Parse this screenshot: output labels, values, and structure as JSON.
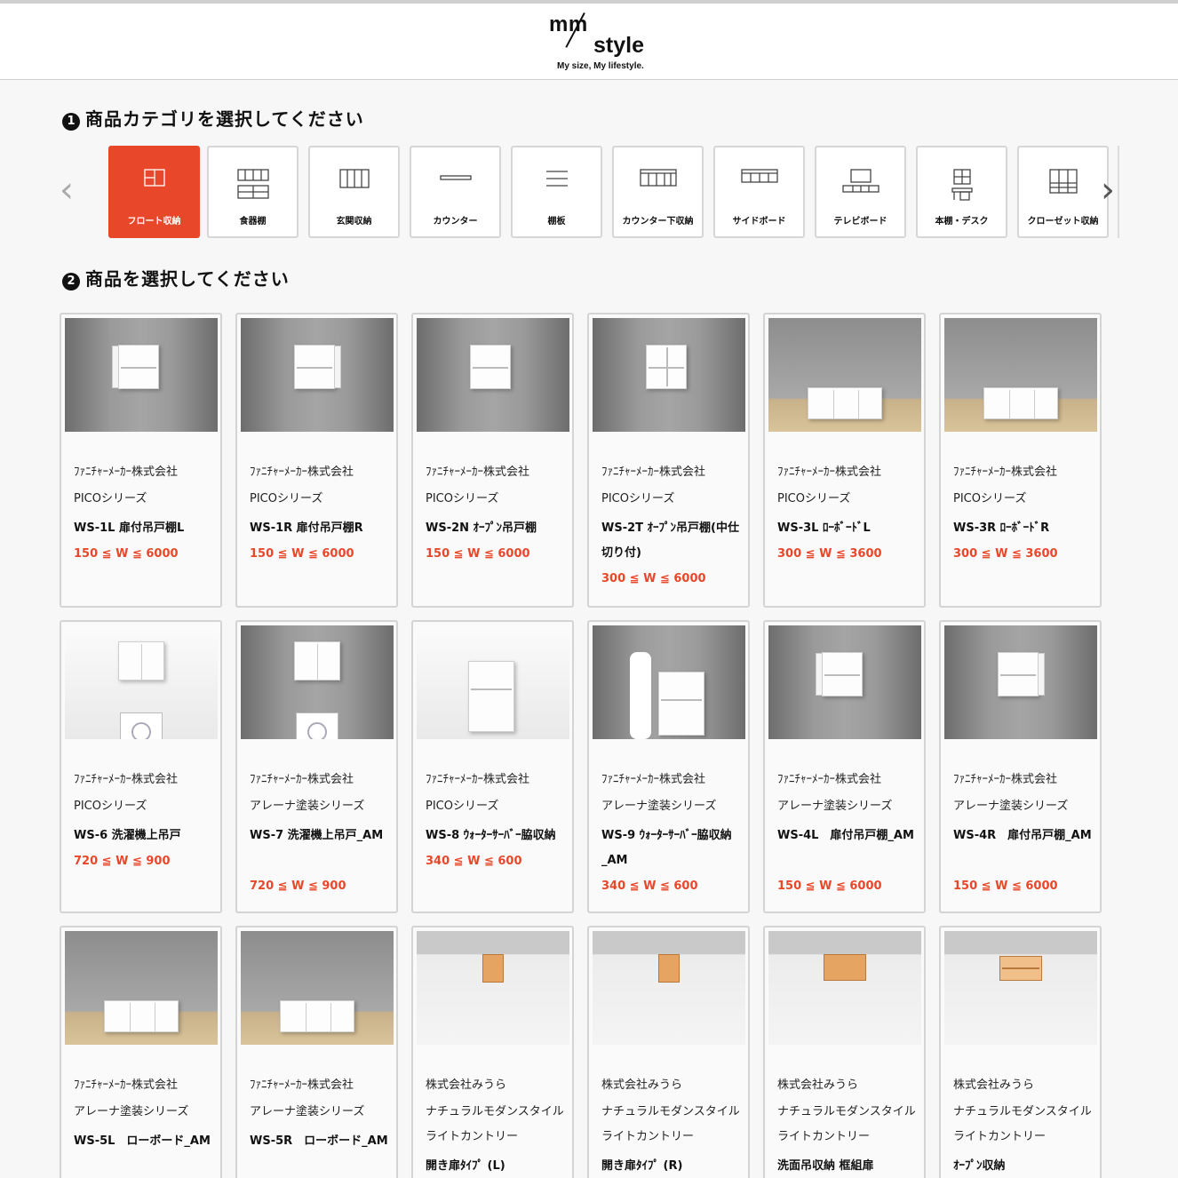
{
  "header": {
    "logo_mm": "mm",
    "logo_style": "style",
    "tagline": "My size, My lifestyle."
  },
  "step1": {
    "num": "1",
    "title": "商品カテゴリを選択してください"
  },
  "step2": {
    "num": "2",
    "title": "商品を選択してください"
  },
  "categories": [
    {
      "label": "フロート収納",
      "icon": "float-storage-icon",
      "active": true
    },
    {
      "label": "食器棚",
      "icon": "cupboard-icon",
      "active": false
    },
    {
      "label": "玄関収納",
      "icon": "entrance-storage-icon",
      "active": false
    },
    {
      "label": "カウンター",
      "icon": "counter-icon",
      "active": false
    },
    {
      "label": "棚板",
      "icon": "shelf-board-icon",
      "active": false
    },
    {
      "label": "カウンター下収納",
      "icon": "under-counter-storage-icon",
      "active": false
    },
    {
      "label": "サイドボード",
      "icon": "sideboard-icon",
      "active": false
    },
    {
      "label": "テレビボード",
      "icon": "tv-board-icon",
      "active": false
    },
    {
      "label": "本棚・デスク",
      "icon": "bookshelf-desk-icon",
      "active": false
    },
    {
      "label": "クローゼット収納",
      "icon": "closet-storage-icon",
      "active": false
    }
  ],
  "products": [
    {
      "maker": "ﾌｧﾆﾁｬｰﾒｰｶｰ株式会社",
      "series": "PICOシリーズ",
      "name": "WS-1L 扉付吊戸棚L",
      "range": "150 ≦ W ≦ 6000"
    },
    {
      "maker": "ﾌｧﾆﾁｬｰﾒｰｶｰ株式会社",
      "series": "PICOシリーズ",
      "name": "WS-1R 扉付吊戸棚R",
      "range": "150 ≦ W ≦ 6000"
    },
    {
      "maker": "ﾌｧﾆﾁｬｰﾒｰｶｰ株式会社",
      "series": "PICOシリーズ",
      "name": "WS-2N ｵｰﾌﾟﾝ吊戸棚",
      "range": "150 ≦ W ≦ 6000"
    },
    {
      "maker": "ﾌｧﾆﾁｬｰﾒｰｶｰ株式会社",
      "series": "PICOシリーズ",
      "name": "WS-2T ｵｰﾌﾟﾝ吊戸棚(中仕切り付)",
      "range": "300 ≦ W ≦ 6000"
    },
    {
      "maker": "ﾌｧﾆﾁｬｰﾒｰｶｰ株式会社",
      "series": "PICOシリーズ",
      "name": "WS-3L ﾛｰﾎﾞｰﾄﾞL",
      "range": "300 ≦ W ≦ 3600"
    },
    {
      "maker": "ﾌｧﾆﾁｬｰﾒｰｶｰ株式会社",
      "series": "PICOシリーズ",
      "name": "WS-3R ﾛｰﾎﾞｰﾄﾞR",
      "range": "300 ≦ W ≦ 3600"
    },
    {
      "maker": "ﾌｧﾆﾁｬｰﾒｰｶｰ株式会社",
      "series": "PICOシリーズ",
      "name": "WS-6 洗濯機上吊戸",
      "range": "720 ≦ W ≦ 900"
    },
    {
      "maker": "ﾌｧﾆﾁｬｰﾒｰｶｰ株式会社",
      "series": "アレーナ塗装シリーズ",
      "name": "WS-7 洗濯機上吊戸_AM",
      "range": "720 ≦ W ≦ 900"
    },
    {
      "maker": "ﾌｧﾆﾁｬｰﾒｰｶｰ株式会社",
      "series": "PICOシリーズ",
      "name": "WS-8 ｳｫｰﾀｰｻｰﾊﾞｰ脇収納",
      "range": "340 ≦ W ≦ 600"
    },
    {
      "maker": "ﾌｧﾆﾁｬｰﾒｰｶｰ株式会社",
      "series": "アレーナ塗装シリーズ",
      "name": "WS-9 ｳｫｰﾀｰｻｰﾊﾞｰ脇収納_AM",
      "range": "340 ≦ W ≦ 600"
    },
    {
      "maker": "ﾌｧﾆﾁｬｰﾒｰｶｰ株式会社",
      "series": "アレーナ塗装シリーズ",
      "name": "WS-4L　扉付吊戸棚_AM",
      "range": "150 ≦ W ≦ 6000"
    },
    {
      "maker": "ﾌｧﾆﾁｬｰﾒｰｶｰ株式会社",
      "series": "アレーナ塗装シリーズ",
      "name": "WS-4R　扉付吊戸棚_AM",
      "range": "150 ≦ W ≦ 6000"
    },
    {
      "maker": "ﾌｧﾆﾁｬｰﾒｰｶｰ株式会社",
      "series": "アレーナ塗装シリーズ",
      "name": "WS-5L　ローボード_AM",
      "range": ""
    },
    {
      "maker": "ﾌｧﾆﾁｬｰﾒｰｶｰ株式会社",
      "series": "アレーナ塗装シリーズ",
      "name": "WS-5R　ローボード_AM",
      "range": ""
    },
    {
      "maker": "株式会社みうら",
      "series": "ナチュラルモダンスタイルライトカントリー",
      "name": "開き扉ﾀｲﾌﾟ (L)",
      "range": ""
    },
    {
      "maker": "株式会社みうら",
      "series": "ナチュラルモダンスタイルライトカントリー",
      "name": "開き扉ﾀｲﾌﾟ (R)",
      "range": ""
    },
    {
      "maker": "株式会社みうら",
      "series": "ナチュラルモダンスタイルライトカントリー",
      "name": "洗面吊収納 框組扉",
      "range": ""
    },
    {
      "maker": "株式会社みうら",
      "series": "ナチュラルモダンスタイルライトカントリー",
      "name": "ｵｰﾌﾟﾝ収納",
      "range": ""
    }
  ],
  "colors": {
    "accent": "#e8472a",
    "border": "#d4d4d4"
  }
}
